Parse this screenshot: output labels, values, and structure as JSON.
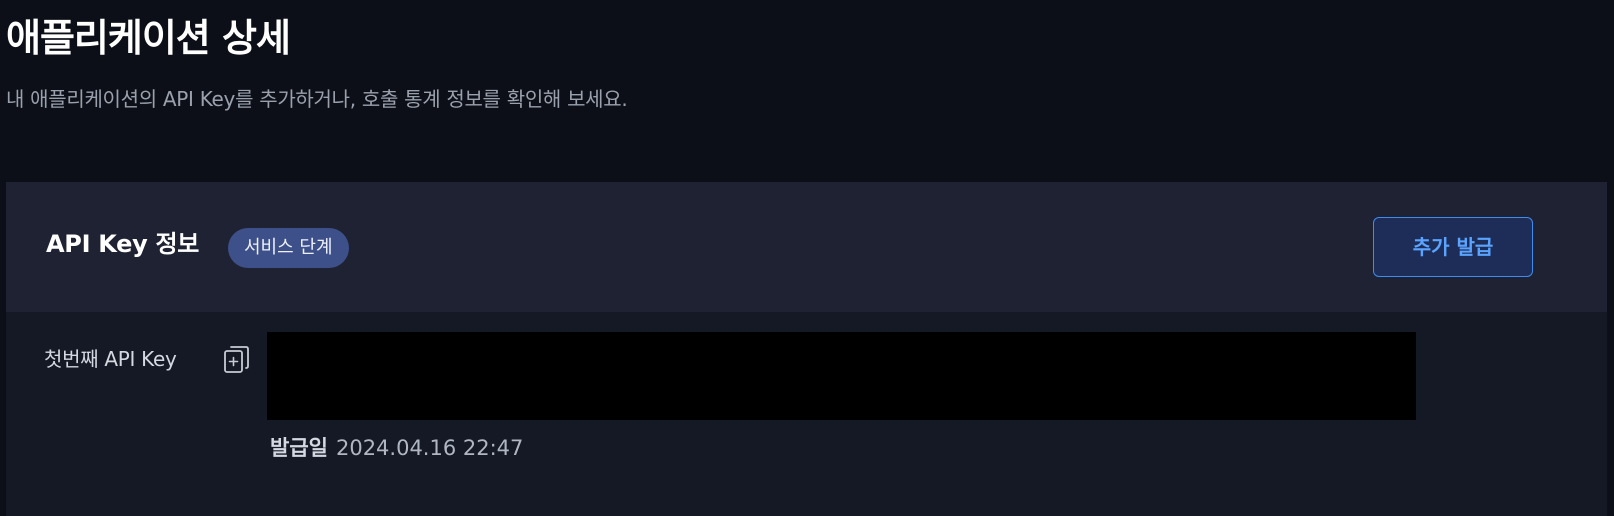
{
  "header": {
    "title": "애플리케이션 상세",
    "subtitle": "내 애플리케이션의 API Key를 추가하거나, 호출 통계 정보를 확인해 보세요."
  },
  "api_key_card": {
    "title": "API Key 정보",
    "stage_badge": "서비스 단계",
    "issue_button": "추가 발급",
    "key_label": "첫번째 API Key",
    "key_value": "",
    "copy_icon": "copy-icon",
    "issued_label": "발급일",
    "issued_date": "2024.04.16 22:47"
  },
  "colors": {
    "background": "#0c0f17",
    "card_header": "#1e2232",
    "card_body": "#141925",
    "badge": "#3d5089",
    "button_border": "#3e8cf0",
    "button_text": "#5aa4ff",
    "button_bg": "#1e2d57"
  }
}
